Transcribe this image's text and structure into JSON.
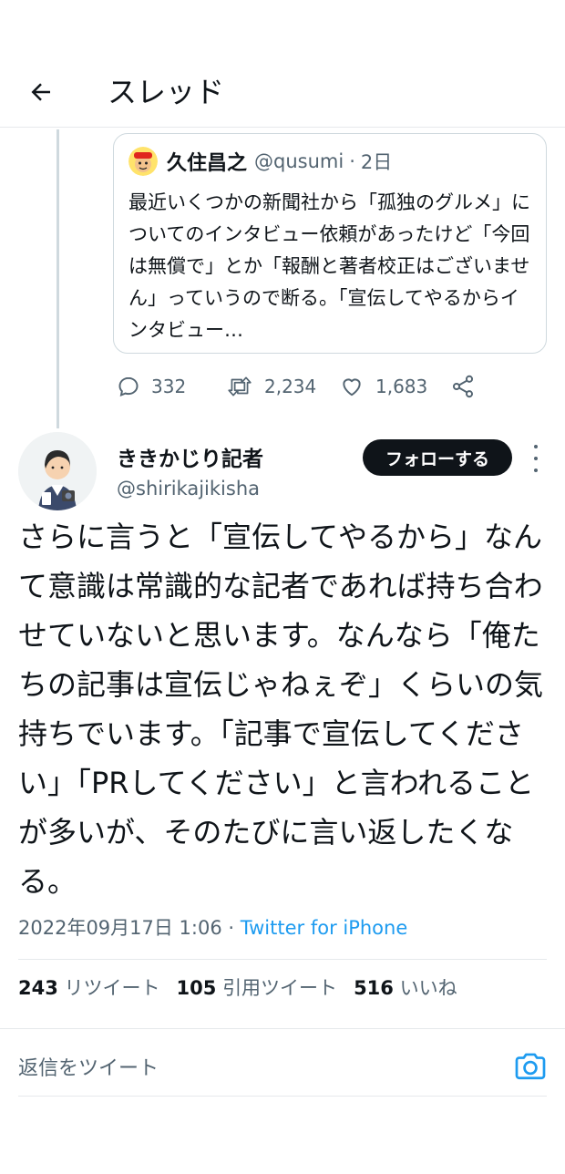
{
  "header": {
    "title": "スレッド"
  },
  "quote": {
    "name": "久住昌之",
    "handle": "@qusumi",
    "separator": "·",
    "time": "2日",
    "text": "最近いくつかの新聞社から「孤独のグルメ」についてのインタビュー依頼があったけど「今回は無償で」とか「報酬と著者校正はございません」っていうので断る。「宣伝してやるからインタビュー…"
  },
  "actions": {
    "reply_count": "332",
    "retweet_count": "2,234",
    "like_count": "1,683"
  },
  "author": {
    "name": "ききかじり記者",
    "handle": "@shirikajikisha",
    "follow_label": "フォローする"
  },
  "tweet": {
    "text": "さらに言うと「宣伝してやるから」なんて意識は常識的な記者であれば持ち合わせていないと思います。なんなら「俺たちの記事は宣伝じゃねぇぞ」くらいの気持ちでいます。「記事で宣伝してください」「PRしてください」と言われることが多いが、そのたびに言い返したくなる。",
    "timestamp": "2022年09月17日 1:06",
    "meta_sep": " · ",
    "source": "Twitter for iPhone"
  },
  "stats": {
    "retweets": "243",
    "retweets_label": "リツイート",
    "quotes": "105",
    "quotes_label": "引用ツイート",
    "likes": "516",
    "likes_label": "いいね"
  },
  "reply": {
    "placeholder": "返信をツイート"
  },
  "colors": {
    "accent": "#1d9bf0",
    "text": "#0f1419",
    "muted": "#536471",
    "border": "#cfd9de"
  },
  "icons": [
    "back-arrow-icon",
    "reply-icon",
    "retweet-icon",
    "like-icon",
    "share-icon",
    "more-icon",
    "camera-icon"
  ]
}
